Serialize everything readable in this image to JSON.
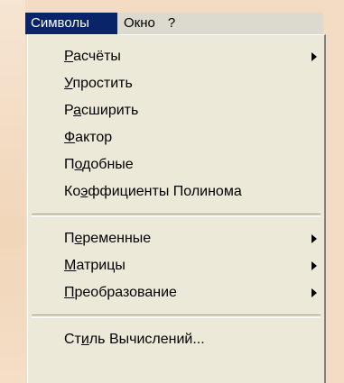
{
  "menubar": {
    "items": [
      {
        "label": "Символы",
        "active": true
      },
      {
        "label": "Окно",
        "active": false
      },
      {
        "label": "?",
        "active": false
      }
    ]
  },
  "dropdown": {
    "items": [
      {
        "before": "",
        "mnemonic": "Р",
        "after": "асчёты",
        "submenu": true
      },
      {
        "before": "",
        "mnemonic": "У",
        "after": "простить",
        "submenu": false
      },
      {
        "before": "Р",
        "mnemonic": "а",
        "after": "сширить",
        "submenu": false
      },
      {
        "before": "",
        "mnemonic": "Ф",
        "after": "актор",
        "submenu": false
      },
      {
        "before": "П",
        "mnemonic": "о",
        "after": "добные",
        "submenu": false
      },
      {
        "before": "Ко",
        "mnemonic": "э",
        "after": "ффициенты Полинома",
        "submenu": false
      },
      {
        "before": "П",
        "mnemonic": "е",
        "after": "ременные",
        "submenu": true
      },
      {
        "before": "",
        "mnemonic": "М",
        "after": "атрицы",
        "submenu": true
      },
      {
        "before": "",
        "mnemonic": "П",
        "after": "реобразование",
        "submenu": true
      },
      {
        "before": "Ст",
        "mnemonic": "и",
        "after": "ль Вычислений...",
        "submenu": false
      }
    ]
  },
  "colors": {
    "menu_bg": "#ece9d8",
    "highlight": "#0a246a",
    "page_bg": "#f3dcc3"
  },
  "icons": {
    "submenu_arrow": "triangle-right-icon"
  }
}
